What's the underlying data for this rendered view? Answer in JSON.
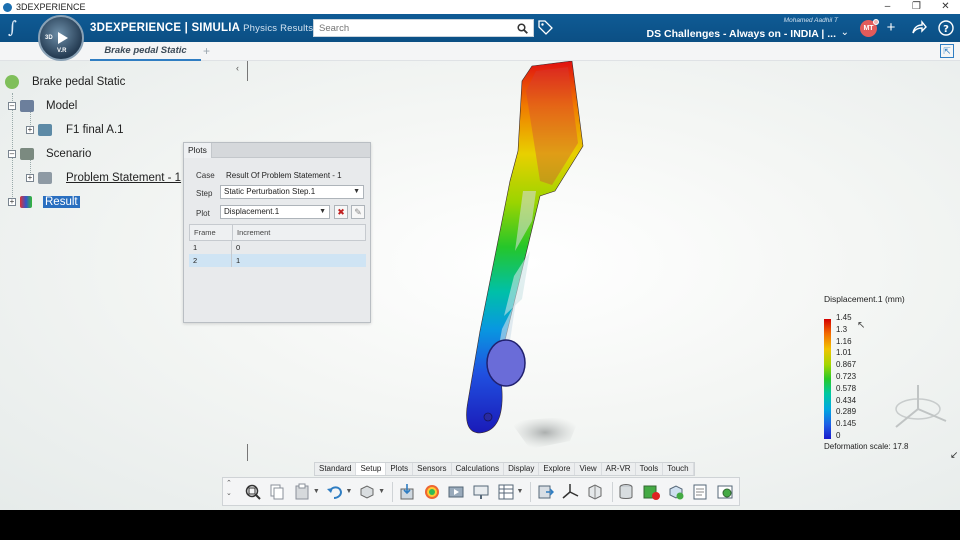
{
  "titlebar": {
    "app_title": "3DEXPERIENCE"
  },
  "topbar": {
    "brand_main": "3DEXPERIENCE | SIMULIA",
    "brand_sub": "Physics Results Explorer",
    "search_placeholder": "Search",
    "user_name": "Mohamed Aadhil T",
    "space_name": "DS Challenges - Always on - INDIA | ...",
    "avatar_initials": "MT"
  },
  "compass": {
    "label_3d": "3D",
    "version": "V.R"
  },
  "tabs": {
    "active": "Brake pedal Static",
    "add": "+"
  },
  "tree": {
    "root": "Brake pedal Static",
    "model": "Model",
    "part": "F1 final A.1",
    "scenario": "Scenario",
    "problem": "Problem Statement - 1",
    "result": "Result"
  },
  "plots": {
    "tab": "Plots",
    "case_label": "Case",
    "case_value": "Result Of Problem Statement - 1",
    "step_label": "Step",
    "step_value": "Static Perturbation Step.1",
    "plot_label": "Plot",
    "plot_value": "Displacement.1",
    "table": {
      "headers": [
        "Frame",
        "Increment"
      ],
      "rows": [
        [
          "1",
          "0"
        ],
        [
          "2",
          "1"
        ]
      ],
      "selected_row": 1
    }
  },
  "legend": {
    "title": "Displacement.1 (mm)",
    "ticks": [
      "1.45",
      "1.3",
      "1.16",
      "1.01",
      "0.867",
      "0.723",
      "0.578",
      "0.434",
      "0.289",
      "0.145",
      "0"
    ],
    "deformation": "Deformation scale: 17.8"
  },
  "command_tabs": [
    "Standard",
    "Setup",
    "Plots",
    "Sensors",
    "Calculations",
    "Display",
    "Explore",
    "View",
    "AR-VR",
    "Tools",
    "Touch"
  ],
  "command_tab_active": "Setup",
  "colors": {
    "brand_blue": "#0f5b95",
    "accent": "#2f7dc2",
    "selection": "#2a6fc0"
  }
}
